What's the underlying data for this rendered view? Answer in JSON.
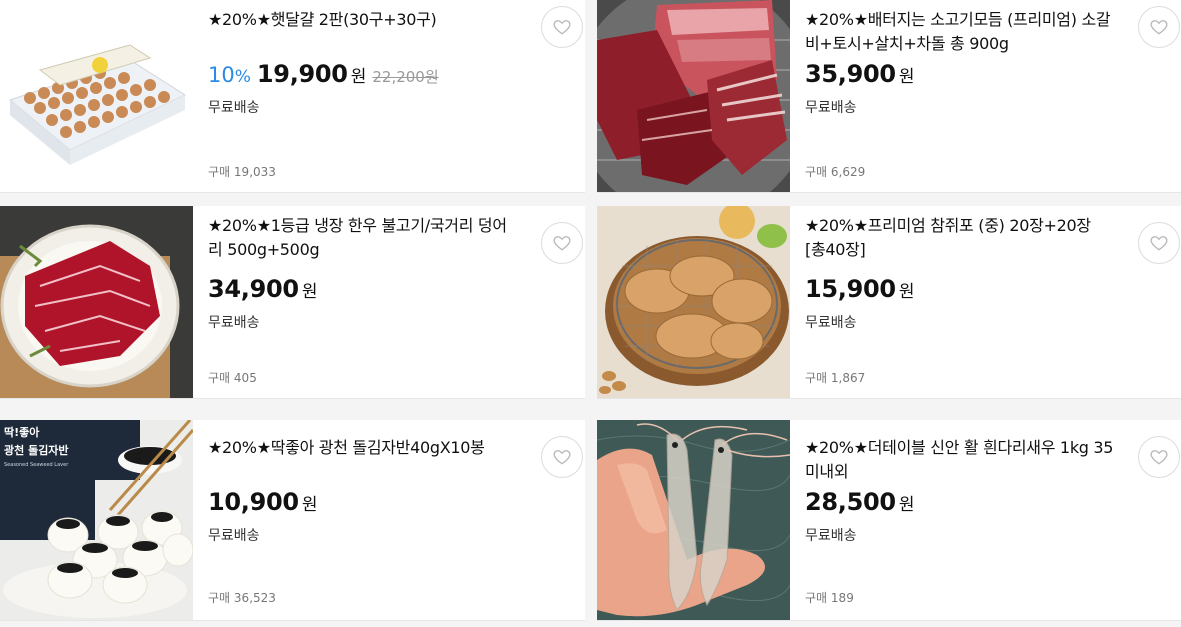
{
  "products": [
    {
      "title": "★20%★햇달걀 2판(30구+30구)",
      "discount": "10",
      "discount_unit": "%",
      "price": "19,900",
      "price_unit": "원",
      "original_price": "22,200원",
      "shipping": "무료배송",
      "purchases_label": "구매",
      "purchases": "19,033",
      "image": "egg-trays"
    },
    {
      "title": "★20%★배터지는 소고기모듬 (프리미엄) 소갈비+토시+살치+차돌 총 900g",
      "price": "35,900",
      "price_unit": "원",
      "shipping": "무료배송",
      "purchases_label": "구매",
      "purchases": "6,629",
      "image": "grilled-beef"
    },
    {
      "title": "★20%★1등급 냉장 한우 불고기/국거리 덩어리 500g+500g",
      "price": "34,900",
      "price_unit": "원",
      "shipping": "무료배송",
      "purchases_label": "구매",
      "purchases": "405",
      "image": "raw-beef-plate"
    },
    {
      "title": "★20%★프리미엄 참쥐포 (중) 20장+20장 [총40장]",
      "price": "15,900",
      "price_unit": "원",
      "shipping": "무료배송",
      "purchases_label": "구매",
      "purchases": "1,867",
      "image": "filefish-jerky"
    },
    {
      "title": "★20%★딱좋아 광천 돌김자반40gX10봉",
      "price": "10,900",
      "price_unit": "원",
      "shipping": "무료배송",
      "purchases_label": "구매",
      "purchases": "36,523",
      "image": "seaweed-rice-balls",
      "package_text": [
        "딱!좋아",
        "광천 돌김자반",
        "Seasoned Seaweed Laver"
      ]
    },
    {
      "title": "★20%★더테이블 신안 활 흰다리새우 1kg 35미내외",
      "price": "28,500",
      "price_unit": "원",
      "shipping": "무료배송",
      "purchases_label": "구매",
      "purchases": "189",
      "image": "live-shrimp"
    }
  ],
  "colors": {
    "discount": "#2a8ae6",
    "price": "#111111",
    "muted": "#777777",
    "background": "#f4f4f4"
  },
  "icons": {
    "wishlist": "heart-outline-icon"
  }
}
